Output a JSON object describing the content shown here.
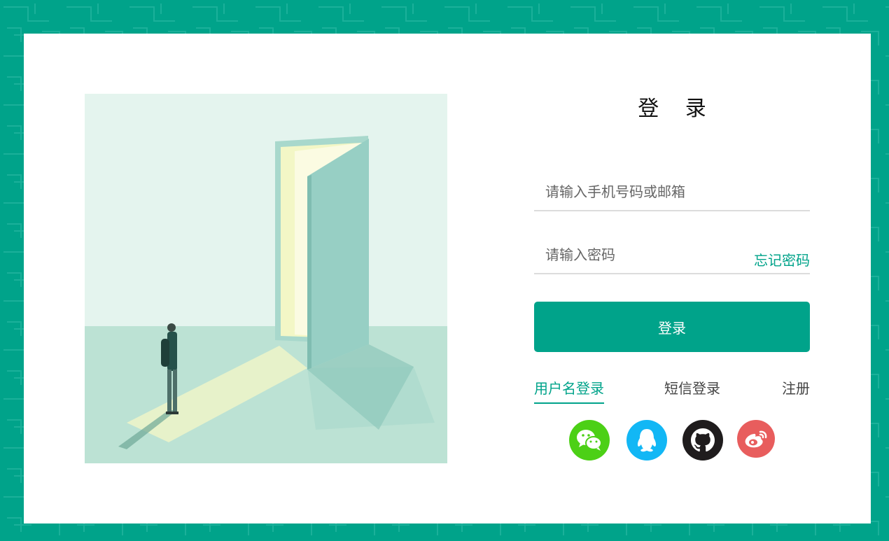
{
  "page": {
    "title": "登 录",
    "colors": {
      "accent": "#00a38a",
      "wechat": "#4cd016",
      "qq": "#12b7f5",
      "github": "#1f1c1d",
      "weibo": "#e85d5d"
    }
  },
  "form": {
    "account": {
      "placeholder": "请输入手机号码或邮箱",
      "value": ""
    },
    "password": {
      "placeholder": "请输入密码",
      "value": ""
    },
    "forgot_label": "忘记密码",
    "login_label": "登录"
  },
  "tabs": [
    {
      "label": "用户名登录",
      "active": true
    },
    {
      "label": "短信登录",
      "active": false
    },
    {
      "label": "注册",
      "active": false
    }
  ],
  "social": [
    {
      "name": "wechat",
      "icon": "wechat-icon"
    },
    {
      "name": "qq",
      "icon": "qq-icon"
    },
    {
      "name": "github",
      "icon": "github-icon"
    },
    {
      "name": "weibo",
      "icon": "weibo-icon"
    }
  ]
}
